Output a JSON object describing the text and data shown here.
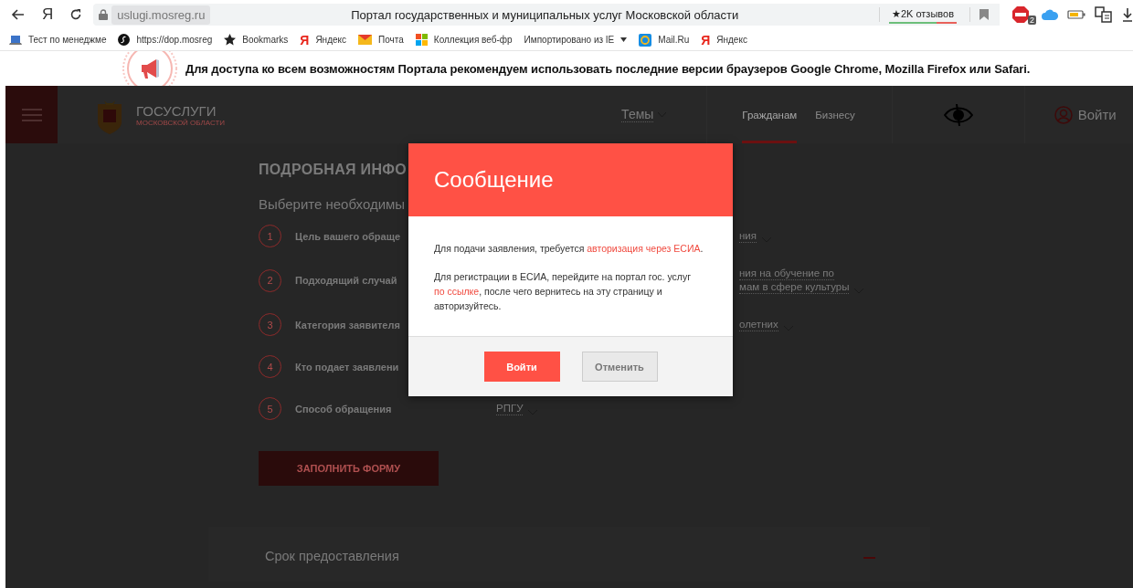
{
  "browser": {
    "yandex_button": "Я",
    "domain": "uslugi.mosreg.ru",
    "title": "Портал государственных и муниципальных услуг Московской области",
    "reviews": "★2K отзывов",
    "extensions": [
      {
        "kind": "adblock",
        "badge": "2"
      },
      {
        "kind": "cloud"
      },
      {
        "kind": "battery"
      },
      {
        "kind": "translate"
      },
      {
        "kind": "download"
      }
    ]
  },
  "bookmarks": [
    {
      "kind": "app",
      "label": "Тест по менеджме"
    },
    {
      "kind": "site",
      "label": "https://dop.mosreg"
    },
    {
      "kind": "star",
      "label": "Bookmarks"
    },
    {
      "kind": "yandex",
      "icon_text": "Я",
      "label": "Яндекс"
    },
    {
      "kind": "mail",
      "label": "Почта"
    },
    {
      "kind": "windows",
      "label": "Коллекция веб-фр"
    },
    {
      "kind": "plain",
      "label": "Импортировано из IE",
      "dropdown": true
    },
    {
      "kind": "mailru",
      "label": "Mail.Ru"
    },
    {
      "kind": "yandex",
      "icon_text": "Я",
      "label": "Яндекс"
    }
  ],
  "notice": {
    "text": "Для доступа ко всем возможностям Портала рекомендуем использовать последние версии браузеров Google Chrome, Mozilla Firefox или Safari."
  },
  "site_header": {
    "brand": "ГОСУСЛУГИ",
    "region": "МОСКОВСКОЙ ОБЛАСТИ",
    "topics": "Темы",
    "audience_tabs": [
      {
        "label": "Гражданам",
        "selected": true
      },
      {
        "label": "Бизнесу",
        "selected": false
      }
    ],
    "login": "Войти"
  },
  "content": {
    "heading": "ПОДРОБНАЯ ИНФО",
    "subheading": "Выберите необходимы",
    "steps": [
      {
        "number": "1",
        "label": "Цель вашего обраще",
        "kind": "partly-hidden",
        "value": [
          "ния"
        ]
      },
      {
        "number": "2",
        "label": "Подходящий случай",
        "kind": "partly-hidden",
        "value": [
          "ния на обучение по",
          "мам в сфере культуры"
        ]
      },
      {
        "number": "3",
        "label": "Категория заявителя",
        "kind": "partly-hidden",
        "value": [
          "олетних"
        ]
      },
      {
        "number": "4",
        "label": "Кто подает заявлени",
        "kind": "partly-hidden"
      },
      {
        "number": "5",
        "label": "Способ обращения",
        "kind": "full",
        "value": [
          "РПГУ"
        ]
      }
    ],
    "submit": "ЗАПОЛНИТЬ ФОРМУ",
    "section": "Срок предоставления"
  },
  "dialog": {
    "title": "Сообщение",
    "paragraphs": [
      [
        {
          "text": "Для подачи заявления, требуется ",
          "link": false
        },
        {
          "text": "авторизация через ЕСИА",
          "link": true
        },
        {
          "text": ".",
          "link": false
        }
      ],
      [
        {
          "text": "Для регистрации в ЕСИА, перейдите на портал гос. услуг ",
          "link": false
        },
        {
          "text": "по ссылке",
          "link": true
        },
        {
          "text": ", после чего вернитесь на эту страницу и авторизуйтесь.",
          "link": false
        }
      ]
    ],
    "buttons": [
      {
        "label": "Войти",
        "kind": "primary"
      },
      {
        "label": "Отменить",
        "kind": "secondary"
      }
    ]
  }
}
